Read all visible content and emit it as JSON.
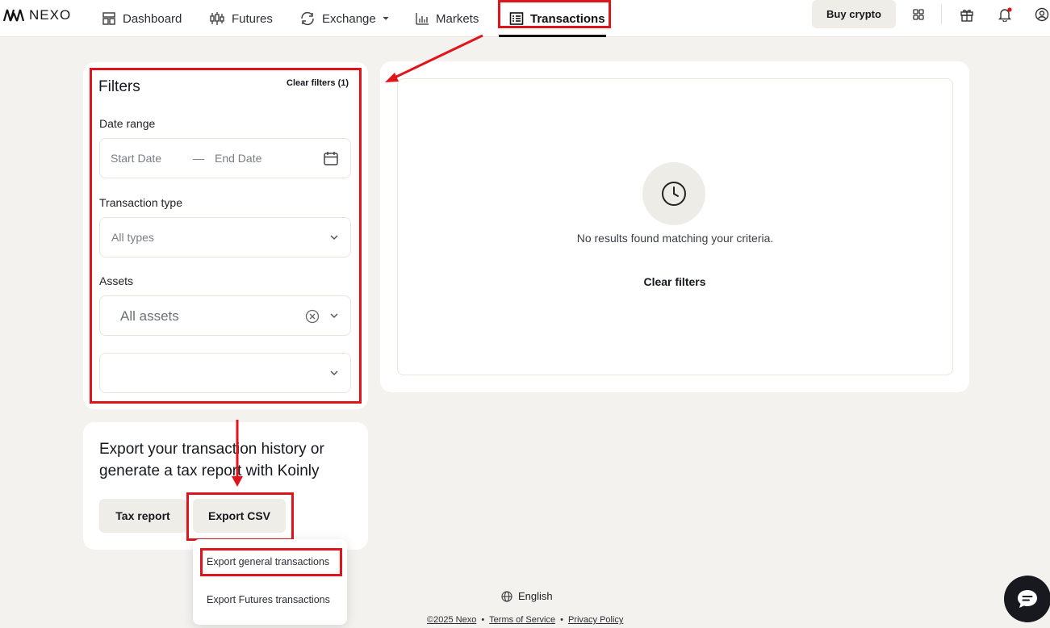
{
  "brand": {
    "name": "NEXO"
  },
  "nav": {
    "dashboard": "Dashboard",
    "futures": "Futures",
    "exchange": "Exchange",
    "markets": "Markets",
    "transactions": "Transactions"
  },
  "header": {
    "buy_crypto": "Buy crypto"
  },
  "filters": {
    "title": "Filters",
    "clear_link": "Clear filters (1)",
    "date_range_label": "Date range",
    "start_date_placeholder": "Start Date",
    "date_separator": "—",
    "end_date_placeholder": "End Date",
    "transaction_type_label": "Transaction type",
    "transaction_type_value": "All types",
    "assets_label": "Assets",
    "assets_value": "All assets",
    "extra_select_value": ""
  },
  "results": {
    "empty_message": "No results found matching your criteria.",
    "clear_button": "Clear filters"
  },
  "export": {
    "heading": "Export your transaction history or generate a tax report with Koinly",
    "tax_report_button": "Tax report",
    "export_csv_button": "Export CSV",
    "menu": [
      "Export general transactions",
      "Export Futures transactions"
    ]
  },
  "footer": {
    "language": "English",
    "copyright": "©2025 Nexo",
    "terms": "Terms of Service",
    "privacy": "Privacy Policy",
    "separator": "•"
  },
  "colors": {
    "highlight": "#e0141b",
    "background": "#f3f2ef",
    "button_bg": "#efede8",
    "text": "#16181d",
    "notification_dot": "#e0141b"
  }
}
